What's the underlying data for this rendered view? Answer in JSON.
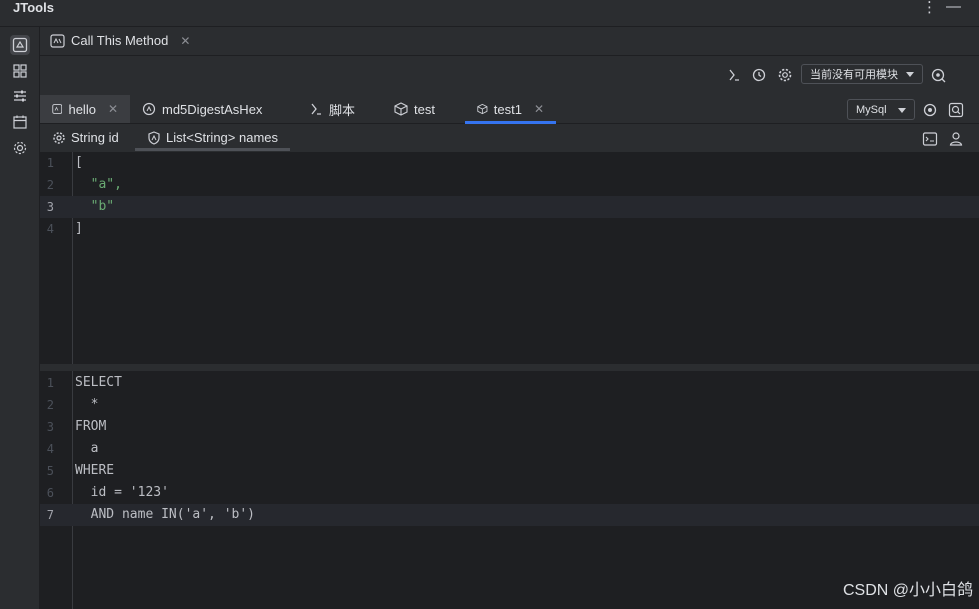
{
  "app": {
    "title": "JTools"
  },
  "toolwindow": {
    "tab_label": "Call This Method"
  },
  "toolbar": {
    "module_select": "当前没有可用模块",
    "db_select": "MySql"
  },
  "editor_tabs": [
    {
      "label": "hello",
      "icon": "method-icon",
      "closable": true
    },
    {
      "label": "md5DigestAsHex",
      "icon": "spring-method-icon",
      "closable": false
    },
    {
      "label": "脚本",
      "icon": "groovy-script-icon",
      "closable": false
    },
    {
      "label": "test",
      "icon": "cube-icon",
      "closable": false
    },
    {
      "label": "test1",
      "icon": "cube-icon",
      "closable": true,
      "active": true
    }
  ],
  "param_tabs": [
    {
      "label": "String id",
      "icon": "gear-icon"
    },
    {
      "label": "List<String> names",
      "icon": "shield-icon",
      "active": true
    }
  ],
  "json_editor": {
    "lines": [
      {
        "num": "1",
        "text": "["
      },
      {
        "num": "2",
        "text": "  \"a\","
      },
      {
        "num": "3",
        "text": "  \"b\""
      },
      {
        "num": "4",
        "text": "]"
      }
    ],
    "current_line": 3
  },
  "sql_editor": {
    "lines": [
      {
        "num": "1",
        "text": "SELECT"
      },
      {
        "num": "2",
        "text": "  *"
      },
      {
        "num": "3",
        "text": "FROM"
      },
      {
        "num": "4",
        "text": "  a"
      },
      {
        "num": "5",
        "text": "WHERE"
      },
      {
        "num": "6",
        "text": "  id = '123'"
      },
      {
        "num": "7",
        "text": "  AND name IN('a', 'b')"
      }
    ],
    "current_line": 7
  },
  "watermark": "CSDN @小小白鸽",
  "colors": {
    "accent": "#3574f0",
    "string": "#6aab73",
    "background": "#1e1f22",
    "panel": "#2b2d30"
  }
}
